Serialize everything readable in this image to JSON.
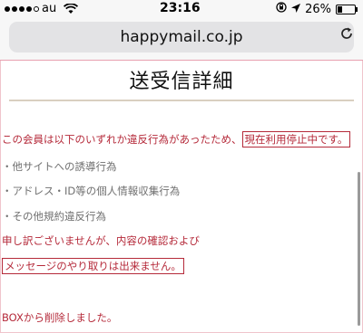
{
  "status": {
    "carrier": "au",
    "time": "23:16",
    "battery": "26%",
    "battery_level": 0.26,
    "icons": [
      "signal-dots",
      "wifi-icon",
      "orientation-lock-icon",
      "location-arrow-icon",
      "battery-icon"
    ]
  },
  "browser": {
    "url": "happymail.co.jp",
    "reload_icon": "reload-icon"
  },
  "page": {
    "title": "送受信詳細",
    "notice_prefix": "この会員は以下のいずれか違反行為があったため、",
    "notice_boxed": "現在利用停止中です。",
    "violations": [
      "・他サイトへの誘導行為",
      "・アドレス・ID等の個人情報収集行為",
      "・その他規約違反行為"
    ],
    "apology_line1": "申し訳ございませんが、内容の確認および",
    "apology_line2": "メッセージのやり取りは出来ません。",
    "deleted_notice": "BOXから削除しました。"
  },
  "colors": {
    "accent_red": "#b52a3a",
    "gray_text": "#707070"
  }
}
